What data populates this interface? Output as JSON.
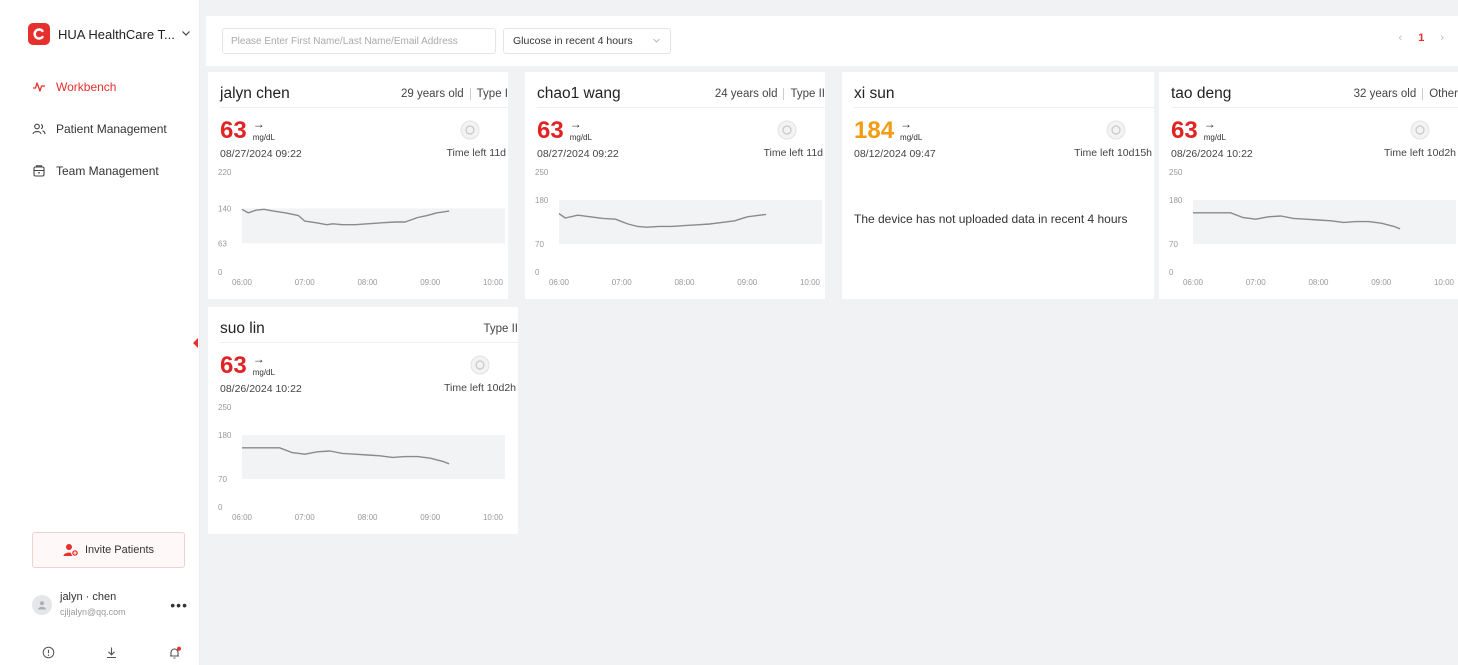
{
  "sidebar": {
    "org_name": "HUA HealthCare T...",
    "nav": [
      {
        "label": "Workbench",
        "icon": "pulse-icon"
      },
      {
        "label": "Patient Management",
        "icon": "users-icon"
      },
      {
        "label": "Team Management",
        "icon": "team-icon"
      }
    ],
    "invite_label": "Invite Patients",
    "user": {
      "name": "jalyn · chen",
      "email": "cjljalyn@qq.com"
    }
  },
  "toolbar": {
    "search_placeholder": "Please Enter First Name/Last Name/Email Address",
    "filter_value": "Glucose in recent 4 hours",
    "pager": {
      "prev": "‹",
      "current": "1",
      "next": "›"
    }
  },
  "colors": {
    "accent": "#e5302d",
    "low": "#e02424",
    "high": "#f39c12",
    "band": "#f2f3f5",
    "line": "#8a8a8a"
  },
  "cards": [
    {
      "name": "jalyn chen",
      "age": "29 years old",
      "type": "Type I",
      "value": "63",
      "trend": "→",
      "unit": "mg/dL",
      "status": "low",
      "datetime": "08/27/2024 09:22",
      "time_left": "Time left 11d",
      "chart": {
        "y_max": 220,
        "band": [
          63,
          140
        ],
        "y_ticks": [
          "220",
          "140",
          "63",
          "0"
        ],
        "x_ticks": [
          "06:00",
          "07:00",
          "08:00",
          "09:00",
          "10:00"
        ],
        "series": [
          [
            6.0,
            138
          ],
          [
            6.1,
            130
          ],
          [
            6.22,
            136
          ],
          [
            6.35,
            138
          ],
          [
            6.5,
            134
          ],
          [
            6.7,
            130
          ],
          [
            6.9,
            124
          ],
          [
            7.0,
            112
          ],
          [
            7.2,
            108
          ],
          [
            7.35,
            104
          ],
          [
            7.45,
            106
          ],
          [
            7.6,
            104
          ],
          [
            7.8,
            104
          ],
          [
            8.0,
            106
          ],
          [
            8.2,
            108
          ],
          [
            8.45,
            110
          ],
          [
            8.6,
            110
          ],
          [
            8.8,
            120
          ],
          [
            8.95,
            124
          ],
          [
            9.1,
            130
          ],
          [
            9.3,
            134
          ]
        ]
      }
    },
    {
      "name": "chao1 wang",
      "age": "24 years old",
      "type": "Type II",
      "value": "63",
      "trend": "→",
      "unit": "mg/dL",
      "status": "low",
      "datetime": "08/27/2024 09:22",
      "time_left": "Time left 11d",
      "chart": {
        "y_max": 250,
        "band": [
          70,
          180
        ],
        "y_ticks": [
          "250",
          "180",
          "70",
          "0"
        ],
        "x_ticks": [
          "06:00",
          "07:00",
          "08:00",
          "09:00",
          "10:00"
        ],
        "series": [
          [
            6.0,
            146
          ],
          [
            6.1,
            135
          ],
          [
            6.3,
            142
          ],
          [
            6.5,
            138
          ],
          [
            6.7,
            134
          ],
          [
            6.9,
            132
          ],
          [
            7.1,
            120
          ],
          [
            7.25,
            114
          ],
          [
            7.4,
            112
          ],
          [
            7.6,
            114
          ],
          [
            7.8,
            114
          ],
          [
            8.0,
            116
          ],
          [
            8.2,
            118
          ],
          [
            8.4,
            120
          ],
          [
            8.6,
            124
          ],
          [
            8.8,
            128
          ],
          [
            9.0,
            138
          ],
          [
            9.2,
            142
          ],
          [
            9.3,
            144
          ]
        ]
      }
    },
    {
      "name": "xi sun",
      "age": "",
      "type": "",
      "value": "184",
      "trend": "→",
      "unit": "mg/dL",
      "status": "high",
      "datetime": "08/12/2024 09:47",
      "time_left": "Time left 10d15h",
      "no_data": "The device has not uploaded data in recent 4 hours"
    },
    {
      "name": "tao deng",
      "age": "32 years old",
      "type": "Other",
      "value": "63",
      "trend": "→",
      "unit": "mg/dL",
      "status": "low",
      "datetime": "08/26/2024 10:22",
      "time_left": "Time left 10d2h",
      "chart": {
        "y_max": 250,
        "band": [
          70,
          180
        ],
        "y_ticks": [
          "250",
          "180",
          "70",
          "0"
        ],
        "x_ticks": [
          "06:00",
          "07:00",
          "08:00",
          "09:00",
          "10:00"
        ],
        "series": [
          [
            6.0,
            148
          ],
          [
            6.2,
            148
          ],
          [
            6.4,
            148
          ],
          [
            6.6,
            148
          ],
          [
            6.8,
            136
          ],
          [
            7.0,
            132
          ],
          [
            7.2,
            138
          ],
          [
            7.4,
            140
          ],
          [
            7.6,
            134
          ],
          [
            7.8,
            132
          ],
          [
            8.0,
            130
          ],
          [
            8.2,
            128
          ],
          [
            8.4,
            124
          ],
          [
            8.6,
            126
          ],
          [
            8.8,
            126
          ],
          [
            9.0,
            122
          ],
          [
            9.2,
            114
          ],
          [
            9.3,
            108
          ]
        ]
      }
    },
    {
      "name": "suo lin",
      "age": "",
      "type": "Type II",
      "value": "63",
      "trend": "→",
      "unit": "mg/dL",
      "status": "low",
      "datetime": "08/26/2024 10:22",
      "time_left": "Time left 10d2h",
      "chart": {
        "y_max": 250,
        "band": [
          70,
          180
        ],
        "y_ticks": [
          "250",
          "180",
          "70",
          "0"
        ],
        "x_ticks": [
          "06:00",
          "07:00",
          "08:00",
          "09:00",
          "10:00"
        ],
        "series": [
          [
            6.0,
            148
          ],
          [
            6.2,
            148
          ],
          [
            6.4,
            148
          ],
          [
            6.6,
            148
          ],
          [
            6.8,
            136
          ],
          [
            7.0,
            132
          ],
          [
            7.2,
            138
          ],
          [
            7.4,
            140
          ],
          [
            7.6,
            134
          ],
          [
            7.8,
            132
          ],
          [
            8.0,
            130
          ],
          [
            8.2,
            128
          ],
          [
            8.4,
            124
          ],
          [
            8.6,
            126
          ],
          [
            8.8,
            126
          ],
          [
            9.0,
            122
          ],
          [
            9.2,
            114
          ],
          [
            9.3,
            108
          ]
        ]
      }
    }
  ]
}
